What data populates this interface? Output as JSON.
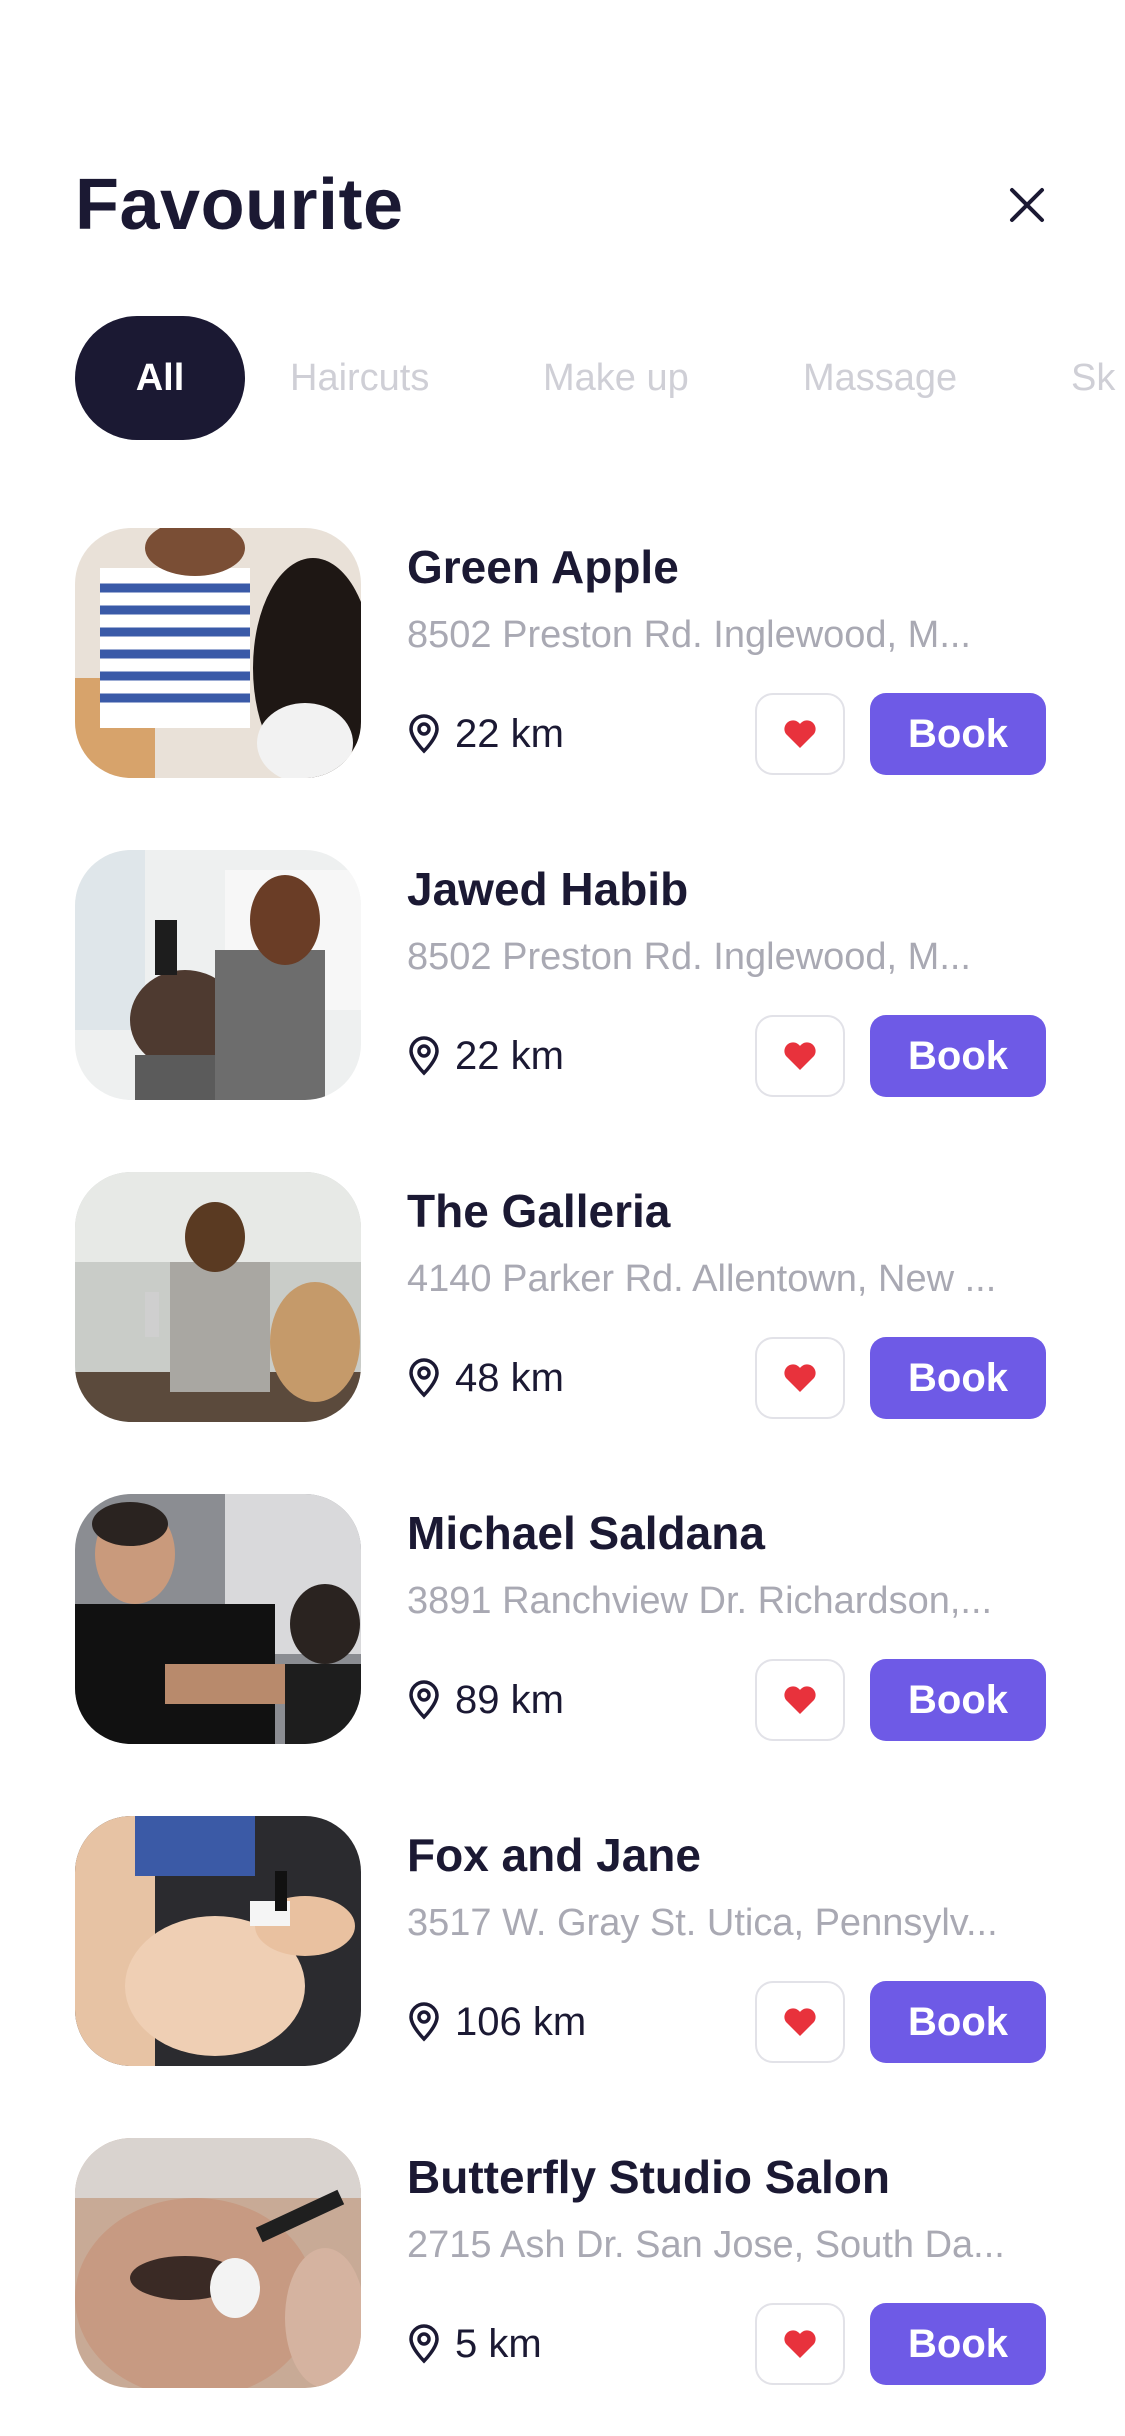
{
  "header": {
    "title": "Favourite",
    "close_icon": "close-icon"
  },
  "filters": [
    {
      "label": "All",
      "active": true
    },
    {
      "label": "Haircuts",
      "active": false
    },
    {
      "label": "Make up",
      "active": false
    },
    {
      "label": "Massage",
      "active": false
    },
    {
      "label": "Sk",
      "active": false
    }
  ],
  "salons": [
    {
      "name": "Green Apple",
      "address": "8502 Preston Rd. Inglewood, M...",
      "distance": "22 km",
      "book_label": "Book",
      "favourited": true
    },
    {
      "name": "Jawed Habib",
      "address": "8502 Preston Rd. Inglewood, M...",
      "distance": "22 km",
      "book_label": "Book",
      "favourited": true
    },
    {
      "name": "The Galleria",
      "address": "4140 Parker Rd. Allentown, New ...",
      "distance": "48 km",
      "book_label": "Book",
      "favourited": true
    },
    {
      "name": "Michael Saldana",
      "address": "3891 Ranchview Dr. Richardson,...",
      "distance": "89 km",
      "book_label": "Book",
      "favourited": true
    },
    {
      "name": "Fox and Jane",
      "address": "3517 W. Gray St. Utica, Pennsylv...",
      "distance": "106 km",
      "book_label": "Book",
      "favourited": true
    },
    {
      "name": "Butterfly Studio Salon",
      "address": "2715 Ash Dr. San Jose, South Da...",
      "distance": "5 km",
      "book_label": "Book",
      "favourited": true
    }
  ],
  "colors": {
    "primary": "#6e5ae6",
    "dark": "#1b1933",
    "heart": "#e8323c",
    "muted_text": "#a9a9b3"
  },
  "icons": {
    "location": "location-pin-icon",
    "favourite": "heart-icon"
  }
}
